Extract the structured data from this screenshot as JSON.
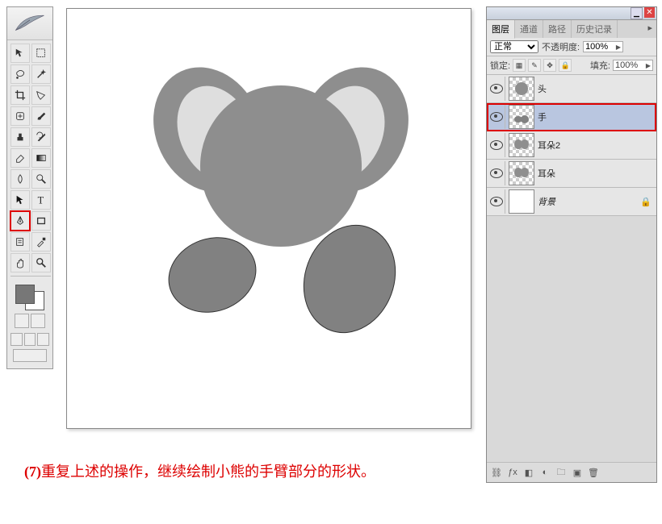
{
  "toolbox": {
    "tools": [
      {
        "name": "move-tool"
      },
      {
        "name": "rect-marquee-tool"
      },
      {
        "name": "lasso-tool"
      },
      {
        "name": "magic-wand-tool"
      },
      {
        "name": "crop-tool"
      },
      {
        "name": "slice-tool"
      },
      {
        "name": "healing-brush-tool"
      },
      {
        "name": "brush-tool"
      },
      {
        "name": "clone-stamp-tool"
      },
      {
        "name": "history-brush-tool"
      },
      {
        "name": "eraser-tool"
      },
      {
        "name": "gradient-tool"
      },
      {
        "name": "blur-tool"
      },
      {
        "name": "dodge-tool"
      },
      {
        "name": "path-select-tool"
      },
      {
        "name": "type-tool"
      },
      {
        "name": "pen-tool"
      },
      {
        "name": "rectangle-tool"
      },
      {
        "name": "notes-tool"
      },
      {
        "name": "eyedropper-tool"
      },
      {
        "name": "hand-tool"
      },
      {
        "name": "zoom-tool"
      }
    ],
    "fg_color": "#777777",
    "bg_color": "#ffffff"
  },
  "layers_panel": {
    "tabs": [
      "图层",
      "通道",
      "路径",
      "历史记录"
    ],
    "active_tab": 0,
    "blend_mode": "正常",
    "opacity_label": "不透明度:",
    "opacity_value": "100%",
    "lock_label": "锁定:",
    "fill_label": "填充:",
    "fill_value": "100%",
    "layers": [
      {
        "name": "头",
        "visible": true,
        "selected": false,
        "thumb": "head"
      },
      {
        "name": "手",
        "visible": true,
        "selected": true,
        "thumb": "hand",
        "highlight": true
      },
      {
        "name": "耳朵2",
        "visible": true,
        "selected": false,
        "thumb": "ear"
      },
      {
        "name": "耳朵",
        "visible": true,
        "selected": false,
        "thumb": "ear"
      },
      {
        "name": "背景",
        "visible": true,
        "selected": false,
        "thumb": "bg",
        "locked": true,
        "italic": true
      }
    ]
  },
  "caption": {
    "num": "(7)",
    "text": "重复上述的操作，继续绘制小熊的手臂部分的形状。"
  }
}
